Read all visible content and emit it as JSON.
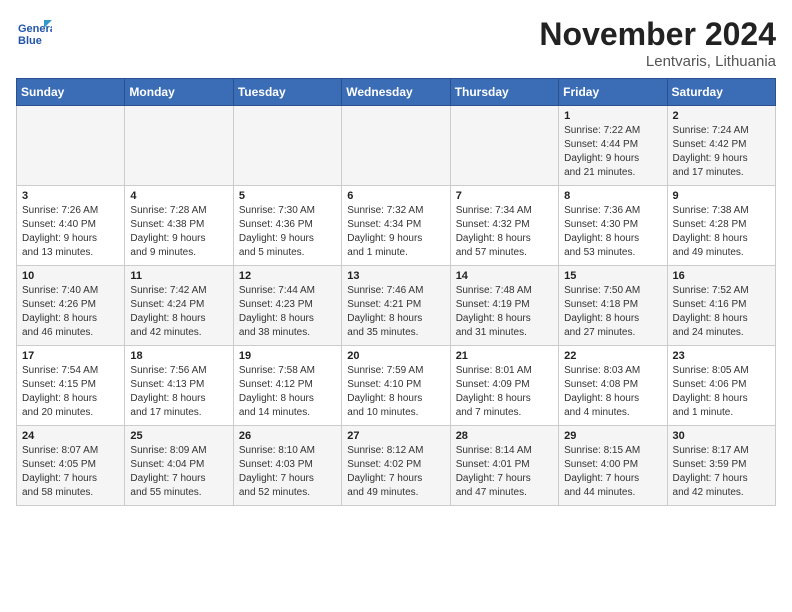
{
  "logo": {
    "line1": "General",
    "line2": "Blue"
  },
  "title": "November 2024",
  "location": "Lentvaris, Lithuania",
  "weekdays": [
    "Sunday",
    "Monday",
    "Tuesday",
    "Wednesday",
    "Thursday",
    "Friday",
    "Saturday"
  ],
  "rows": [
    [
      {
        "day": "",
        "info": ""
      },
      {
        "day": "",
        "info": ""
      },
      {
        "day": "",
        "info": ""
      },
      {
        "day": "",
        "info": ""
      },
      {
        "day": "",
        "info": ""
      },
      {
        "day": "1",
        "info": "Sunrise: 7:22 AM\nSunset: 4:44 PM\nDaylight: 9 hours\nand 21 minutes."
      },
      {
        "day": "2",
        "info": "Sunrise: 7:24 AM\nSunset: 4:42 PM\nDaylight: 9 hours\nand 17 minutes."
      }
    ],
    [
      {
        "day": "3",
        "info": "Sunrise: 7:26 AM\nSunset: 4:40 PM\nDaylight: 9 hours\nand 13 minutes."
      },
      {
        "day": "4",
        "info": "Sunrise: 7:28 AM\nSunset: 4:38 PM\nDaylight: 9 hours\nand 9 minutes."
      },
      {
        "day": "5",
        "info": "Sunrise: 7:30 AM\nSunset: 4:36 PM\nDaylight: 9 hours\nand 5 minutes."
      },
      {
        "day": "6",
        "info": "Sunrise: 7:32 AM\nSunset: 4:34 PM\nDaylight: 9 hours\nand 1 minute."
      },
      {
        "day": "7",
        "info": "Sunrise: 7:34 AM\nSunset: 4:32 PM\nDaylight: 8 hours\nand 57 minutes."
      },
      {
        "day": "8",
        "info": "Sunrise: 7:36 AM\nSunset: 4:30 PM\nDaylight: 8 hours\nand 53 minutes."
      },
      {
        "day": "9",
        "info": "Sunrise: 7:38 AM\nSunset: 4:28 PM\nDaylight: 8 hours\nand 49 minutes."
      }
    ],
    [
      {
        "day": "10",
        "info": "Sunrise: 7:40 AM\nSunset: 4:26 PM\nDaylight: 8 hours\nand 46 minutes."
      },
      {
        "day": "11",
        "info": "Sunrise: 7:42 AM\nSunset: 4:24 PM\nDaylight: 8 hours\nand 42 minutes."
      },
      {
        "day": "12",
        "info": "Sunrise: 7:44 AM\nSunset: 4:23 PM\nDaylight: 8 hours\nand 38 minutes."
      },
      {
        "day": "13",
        "info": "Sunrise: 7:46 AM\nSunset: 4:21 PM\nDaylight: 8 hours\nand 35 minutes."
      },
      {
        "day": "14",
        "info": "Sunrise: 7:48 AM\nSunset: 4:19 PM\nDaylight: 8 hours\nand 31 minutes."
      },
      {
        "day": "15",
        "info": "Sunrise: 7:50 AM\nSunset: 4:18 PM\nDaylight: 8 hours\nand 27 minutes."
      },
      {
        "day": "16",
        "info": "Sunrise: 7:52 AM\nSunset: 4:16 PM\nDaylight: 8 hours\nand 24 minutes."
      }
    ],
    [
      {
        "day": "17",
        "info": "Sunrise: 7:54 AM\nSunset: 4:15 PM\nDaylight: 8 hours\nand 20 minutes."
      },
      {
        "day": "18",
        "info": "Sunrise: 7:56 AM\nSunset: 4:13 PM\nDaylight: 8 hours\nand 17 minutes."
      },
      {
        "day": "19",
        "info": "Sunrise: 7:58 AM\nSunset: 4:12 PM\nDaylight: 8 hours\nand 14 minutes."
      },
      {
        "day": "20",
        "info": "Sunrise: 7:59 AM\nSunset: 4:10 PM\nDaylight: 8 hours\nand 10 minutes."
      },
      {
        "day": "21",
        "info": "Sunrise: 8:01 AM\nSunset: 4:09 PM\nDaylight: 8 hours\nand 7 minutes."
      },
      {
        "day": "22",
        "info": "Sunrise: 8:03 AM\nSunset: 4:08 PM\nDaylight: 8 hours\nand 4 minutes."
      },
      {
        "day": "23",
        "info": "Sunrise: 8:05 AM\nSunset: 4:06 PM\nDaylight: 8 hours\nand 1 minute."
      }
    ],
    [
      {
        "day": "24",
        "info": "Sunrise: 8:07 AM\nSunset: 4:05 PM\nDaylight: 7 hours\nand 58 minutes."
      },
      {
        "day": "25",
        "info": "Sunrise: 8:09 AM\nSunset: 4:04 PM\nDaylight: 7 hours\nand 55 minutes."
      },
      {
        "day": "26",
        "info": "Sunrise: 8:10 AM\nSunset: 4:03 PM\nDaylight: 7 hours\nand 52 minutes."
      },
      {
        "day": "27",
        "info": "Sunrise: 8:12 AM\nSunset: 4:02 PM\nDaylight: 7 hours\nand 49 minutes."
      },
      {
        "day": "28",
        "info": "Sunrise: 8:14 AM\nSunset: 4:01 PM\nDaylight: 7 hours\nand 47 minutes."
      },
      {
        "day": "29",
        "info": "Sunrise: 8:15 AM\nSunset: 4:00 PM\nDaylight: 7 hours\nand 44 minutes."
      },
      {
        "day": "30",
        "info": "Sunrise: 8:17 AM\nSunset: 3:59 PM\nDaylight: 7 hours\nand 42 minutes."
      }
    ]
  ]
}
